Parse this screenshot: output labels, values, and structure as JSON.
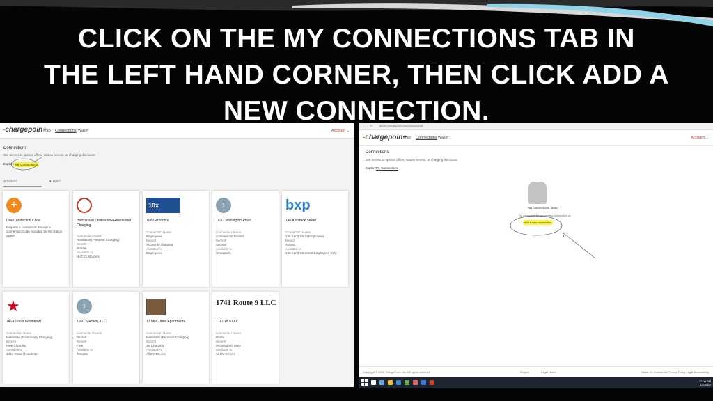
{
  "slide": {
    "title_lines": [
      "CLICK ON THE MY CONNECTIONS TAB IN",
      "THE LEFT HAND CORNER, THEN CLICK ADD A",
      "NEW CONNECTION."
    ]
  },
  "left": {
    "logo": "chargepoin+",
    "nav": {
      "map": "Map",
      "connections": "Connections",
      "wallet": "Wallet",
      "account": "Account ⌄"
    },
    "heading": "Connections",
    "subtext": "Get access to special offers, station access, or charging discounts",
    "tabs": {
      "explore": "Explore",
      "my_connections": "My Connections"
    },
    "search": "Search",
    "filters": "Filters",
    "cards": [
      {
        "name": "Use Connection Code",
        "desc": "Request a connection through a connection Code provided by the station owner",
        "f1l": "",
        "f1": "",
        "f2l": "",
        "f2": "",
        "f3l": "",
        "f3": "",
        "icon": "plus-icon"
      },
      {
        "name": "Hutchinson Utilities MN Residential Charging",
        "desc": "",
        "f1l": "Connection Name",
        "f1": "Residents (Personal Charging)",
        "f2l": "Benefit",
        "f2": "Rebate",
        "f3l": "Available to",
        "f3": "HUC Customers",
        "icon": "seal-icon"
      },
      {
        "name": "10x Genomics",
        "desc": "",
        "f1l": "Connection Name",
        "f1": "Employees",
        "f2l": "Benefit",
        "f2": "Access to charging",
        "f3l": "Available to",
        "f3": "Employees",
        "icon": "10x-logo",
        "icon_text": "10x"
      },
      {
        "name": "11-12 Wellington Plaza",
        "desc": "",
        "f1l": "Connection Name",
        "f1": "Commercial Tenants",
        "f2l": "Benefit",
        "f2": "Access",
        "f3l": "Available to",
        "f3": "Occupants",
        "icon": "avatar-icon",
        "icon_text": "1"
      },
      {
        "name": "140 Kendrick Street",
        "desc": "",
        "f1l": "Connection Name",
        "f1": "140 Kendrick St Employees",
        "f2l": "Benefit",
        "f2": "Access",
        "f3l": "Available to",
        "f3": "140 Kendrick Street Employees Only",
        "icon": "bxp-logo",
        "icon_text": "bxp"
      },
      {
        "name": "1414 Texas Downtown",
        "desc": "",
        "f1l": "Connection Name",
        "f1": "Residents (Community Charging)",
        "f2l": "Benefit",
        "f2": "Free Charging",
        "f3l": "Available to",
        "f3": "1414 Texas Residents",
        "icon": "star-icon"
      },
      {
        "name": "1660 S Albion, LLC",
        "desc": "",
        "f1l": "Connection Name",
        "f1": "Default",
        "f2l": "Benefit",
        "f2": "Free",
        "f3l": "Available to",
        "f3": "Tenants",
        "icon": "avatar-icon",
        "icon_text": "1"
      },
      {
        "name": "17 Mile Drive Apartments",
        "desc": "",
        "f1l": "Connection Name",
        "f1": "Residents (Personal Charging)",
        "f2l": "Benefit",
        "f2": "2V Charging",
        "f3l": "Available to",
        "f3": "All EV Drivers",
        "icon": "photo-icon"
      },
      {
        "name": "1741 Rt 9 LLC",
        "desc": "",
        "f1l": "Connection Name",
        "f1": "Public",
        "f2l": "Benefit",
        "f2": "(Accessible) rates",
        "f3l": "Available to",
        "f3": "All EV Drivers",
        "icon": "text-logo",
        "icon_text": "1741 Route 9 LLC"
      }
    ]
  },
  "right": {
    "url": "driver.chargepoint.com/connections",
    "logo": "chargepoin+",
    "nav": {
      "map": "Map",
      "connections": "Connections",
      "wallet": "Wallet",
      "account": "Account ⌄"
    },
    "heading": "Connections",
    "subtext": "Get access to special offers, station access, or charging discounts",
    "tabs": {
      "explore": "Explore",
      "my_connections": "My Connections"
    },
    "empty_title": "No connections found",
    "empty_sub": "Try searching for an existing connection or",
    "add_link": "add a new connection",
    "footer_left": "Copyright © 2020 ChargePoint, Inc. All rights reserved.",
    "footer_mid1": "English",
    "footer_mid2": "Legal Notes",
    "footer_right": "About Us  Contact Us  Privacy Policy  Legal  Accessibility",
    "clock_time": "12:00 PM",
    "clock_date": "1/1/2020"
  }
}
